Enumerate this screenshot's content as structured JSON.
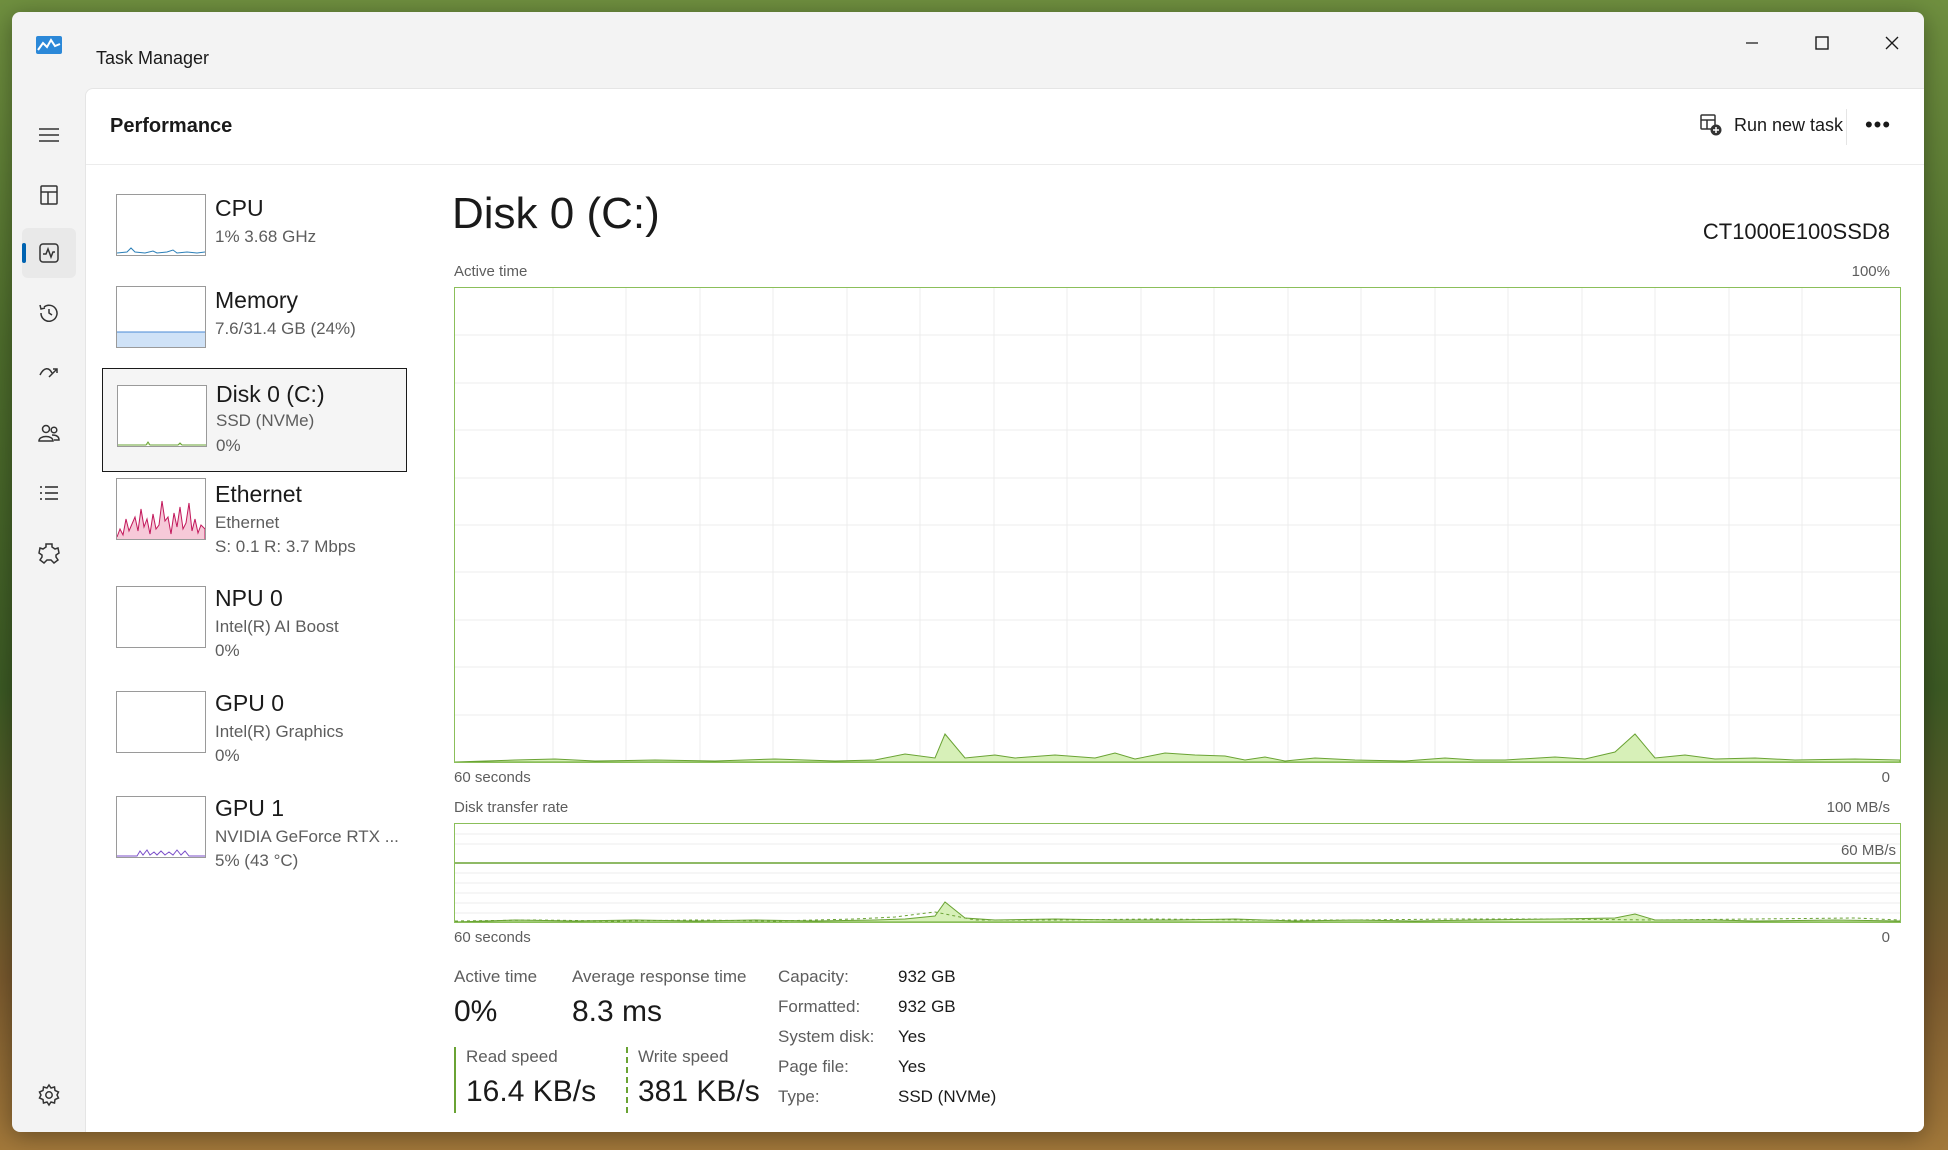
{
  "window": {
    "title": "Task Manager"
  },
  "header": {
    "title": "Performance",
    "run_task_label": "Run new task",
    "more_label": "•••"
  },
  "devices": [
    {
      "name": "CPU",
      "sub1": "1%  3.68 GHz",
      "sub2": ""
    },
    {
      "name": "Memory",
      "sub1": "7.6/31.4 GB (24%)",
      "sub2": ""
    },
    {
      "name": "Disk 0 (C:)",
      "sub1": "SSD (NVMe)",
      "sub2": "0%"
    },
    {
      "name": "Ethernet",
      "sub1": "Ethernet",
      "sub2": "S: 0.1  R: 3.7 Mbps"
    },
    {
      "name": "NPU 0",
      "sub1": "Intel(R) AI Boost",
      "sub2": "0%"
    },
    {
      "name": "GPU 0",
      "sub1": "Intel(R) Graphics",
      "sub2": "0%"
    },
    {
      "name": "GPU 1",
      "sub1": "NVIDIA GeForce RTX ...",
      "sub2": "5% (43 °C)"
    }
  ],
  "detail": {
    "title": "Disk 0 (C:)",
    "model": "CT1000E100SSD8",
    "active_chart": {
      "label": "Active time",
      "max": "100%",
      "time": "60 seconds",
      "min": "0"
    },
    "transfer_chart": {
      "label": "Disk transfer rate",
      "max": "100 MB/s",
      "line_label": "60 MB/s",
      "time": "60 seconds",
      "min": "0"
    },
    "stats": {
      "active_time_label": "Active time",
      "active_time_value": "0%",
      "avg_response_label": "Average response time",
      "avg_response_value": "8.3 ms",
      "read_label": "Read speed",
      "read_value": "16.4 KB/s",
      "write_label": "Write speed",
      "write_value": "381 KB/s"
    },
    "props": [
      {
        "label": "Capacity:",
        "value": "932 GB"
      },
      {
        "label": "Formatted:",
        "value": "932 GB"
      },
      {
        "label": "System disk:",
        "value": "Yes"
      },
      {
        "label": "Page file:",
        "value": "Yes"
      },
      {
        "label": "Type:",
        "value": "SSD (NVMe)"
      }
    ]
  },
  "colors": {
    "accent": "#0063b1",
    "disk_green": "#6aa334",
    "disk_fill": "#d7f0b8",
    "net_pink": "#c2185b"
  },
  "nav_icons": [
    "hamburger-icon",
    "processes-icon",
    "performance-icon",
    "app-history-icon",
    "startup-icon",
    "users-icon",
    "details-icon",
    "services-icon",
    "settings-icon"
  ]
}
